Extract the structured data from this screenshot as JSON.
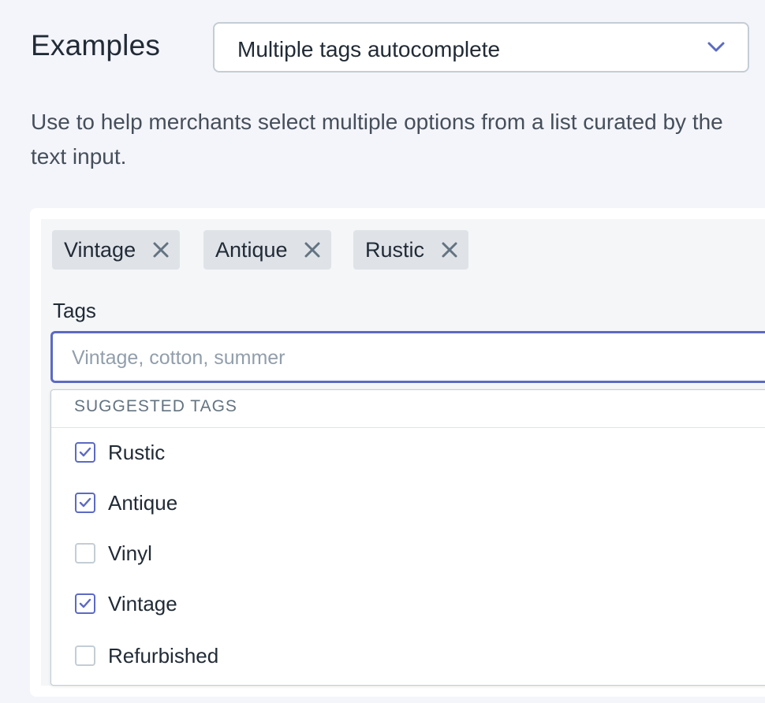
{
  "header": {
    "title": "Examples",
    "select_value": "Multiple tags autocomplete"
  },
  "description": "Use to help merchants select multiple options from a list curated by the text input.",
  "selected_tags": [
    {
      "label": "Vintage"
    },
    {
      "label": "Antique"
    },
    {
      "label": "Rustic"
    }
  ],
  "field": {
    "label": "Tags",
    "value": "",
    "placeholder": "Vintage, cotton, summer"
  },
  "suggestions": {
    "heading": "SUGGESTED TAGS",
    "options": [
      {
        "label": "Rustic",
        "checked": true
      },
      {
        "label": "Antique",
        "checked": true
      },
      {
        "label": "Vinyl",
        "checked": false
      },
      {
        "label": "Vintage",
        "checked": true
      },
      {
        "label": "Refurbished",
        "checked": false
      }
    ]
  },
  "colors": {
    "accent": "#5c6ac4",
    "tag_bg": "#dfe3e8",
    "page_bg": "#f4f5fa"
  },
  "icons": {
    "dropdown": "chevron-down-icon",
    "remove_tag": "close-icon",
    "checkbox_mark": "checkmark-icon"
  }
}
